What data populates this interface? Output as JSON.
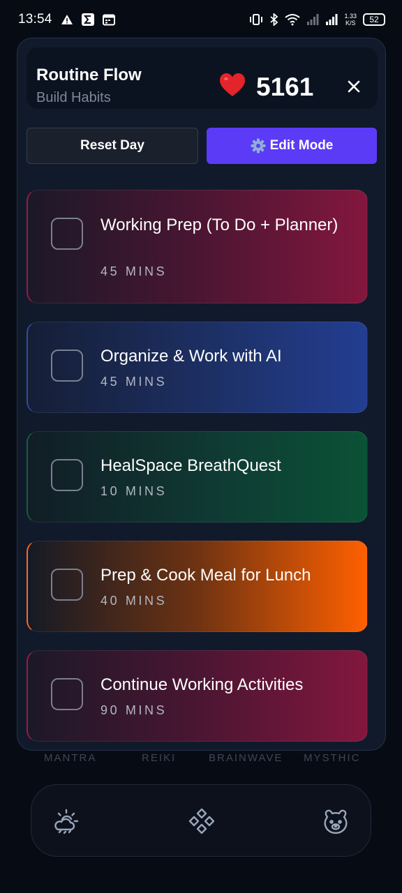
{
  "status_bar": {
    "time": "13:54",
    "net_speed_value": "1.33",
    "net_speed_unit": "K/S",
    "battery": "52",
    "icons": [
      "warning-icon",
      "sigma-icon",
      "calendar-icon",
      "vibrate-icon",
      "bluetooth-icon",
      "wifi-icon",
      "signal-icon"
    ]
  },
  "header": {
    "title": "Routine Flow",
    "subtitle": "Build Habits",
    "score": "5161",
    "heart_icon": "heart-icon",
    "close_icon": "close-icon"
  },
  "actions": {
    "reset_label": "Reset Day",
    "edit_label": "Edit Mode",
    "edit_icon": "gear-icon",
    "edit_color": "#5b3bf5"
  },
  "tasks": [
    {
      "name": "Working Prep (To Do + Planner)",
      "duration": "45 MINS",
      "color": "#83173d"
    },
    {
      "name": "Organize & Work with AI",
      "duration": "45 MINS",
      "color": "#233e91"
    },
    {
      "name": "HealSpace BreathQuest",
      "duration": "10 MINS",
      "color": "#0b5236"
    },
    {
      "name": "Prep & Cook Meal for Lunch",
      "duration": "40 MINS",
      "color": "#ff6000"
    },
    {
      "name": "Continue Working Activities",
      "duration": "90 MINS",
      "color": "#83173d"
    }
  ],
  "background_tabs": [
    "MANTRA",
    "REIKI",
    "BRAINWAVE",
    "MYSTHIC"
  ],
  "bottom_nav": {
    "items": [
      "weather-icon",
      "diamond-grid-icon",
      "pet-face-icon"
    ]
  }
}
